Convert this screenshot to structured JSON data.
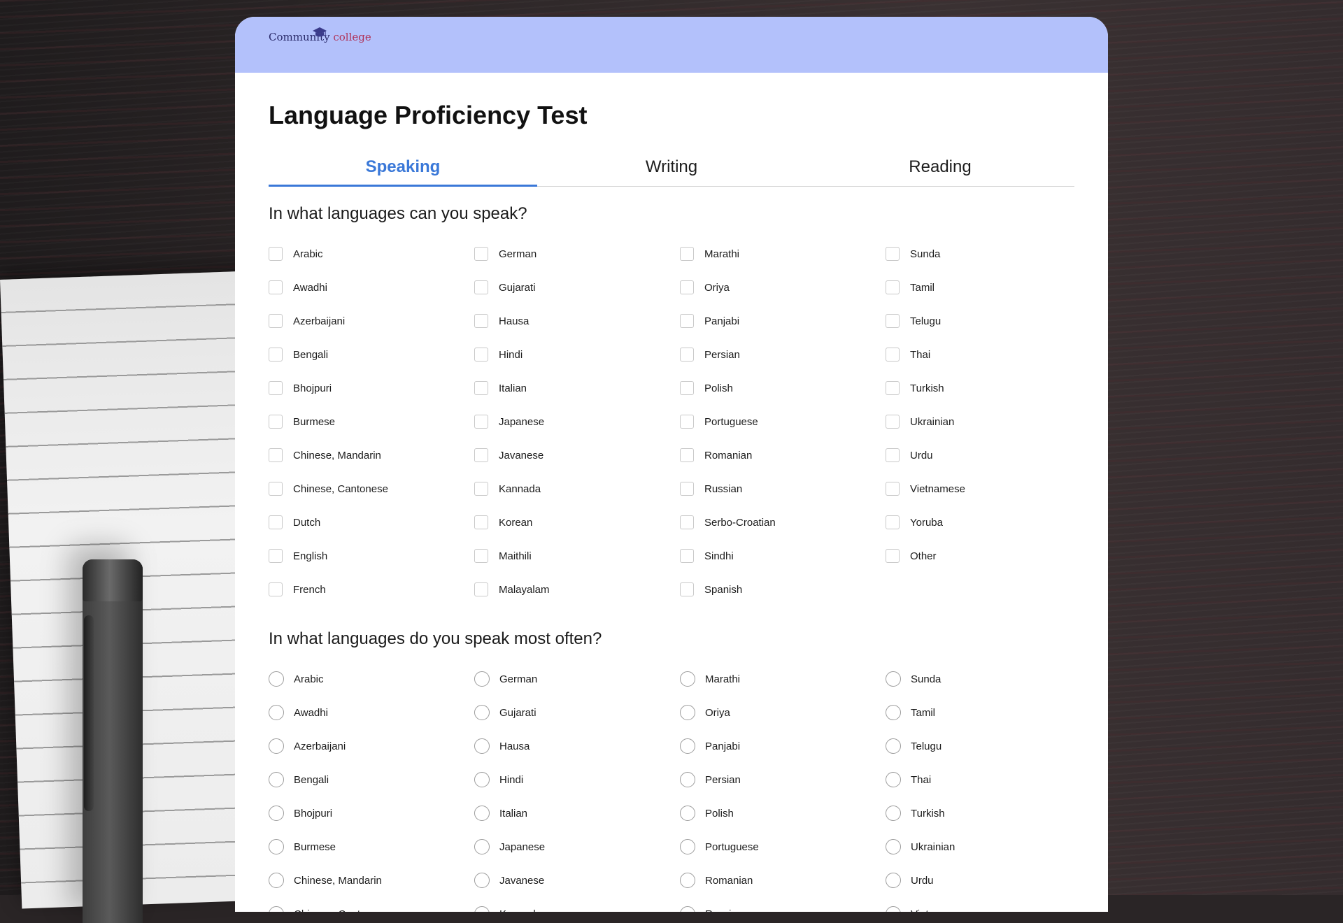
{
  "header": {
    "logo_word1": "Community",
    "logo_word2": "college"
  },
  "page": {
    "title": "Language Proficiency Test"
  },
  "tabs": [
    {
      "label": "Speaking",
      "active": true
    },
    {
      "label": "Writing",
      "active": false
    },
    {
      "label": "Reading",
      "active": false
    }
  ],
  "questions": {
    "q1": "In what languages can you speak?",
    "q2": "In what languages do you speak most often?"
  },
  "languages_checkbox": [
    "Arabic",
    "German",
    "Marathi",
    "Sunda",
    "Awadhi",
    "Gujarati",
    "Oriya",
    "Tamil",
    "Azerbaijani",
    "Hausa",
    "Panjabi",
    "Telugu",
    "Bengali",
    "Hindi",
    "Persian",
    "Thai",
    "Bhojpuri",
    "Italian",
    "Polish",
    "Turkish",
    "Burmese",
    "Japanese",
    "Portuguese",
    "Ukrainian",
    "Chinese, Mandarin",
    "Javanese",
    "Romanian",
    "Urdu",
    "Chinese, Cantonese",
    "Kannada",
    "Russian",
    "Vietnamese",
    "Dutch",
    "Korean",
    "Serbo-Croatian",
    "Yoruba",
    "English",
    "Maithili",
    "Sindhi",
    "Other",
    "French",
    "Malayalam",
    "Spanish"
  ],
  "languages_radio": [
    "Arabic",
    "German",
    "Marathi",
    "Sunda",
    "Awadhi",
    "Gujarati",
    "Oriya",
    "Tamil",
    "Azerbaijani",
    "Hausa",
    "Panjabi",
    "Telugu",
    "Bengali",
    "Hindi",
    "Persian",
    "Thai",
    "Bhojpuri",
    "Italian",
    "Polish",
    "Turkish",
    "Burmese",
    "Japanese",
    "Portuguese",
    "Ukrainian",
    "Chinese, Mandarin",
    "Javanese",
    "Romanian",
    "Urdu",
    "Chinese, Cantonese",
    "Kannada",
    "Russian",
    "Vietnamese"
  ],
  "colors": {
    "accent": "#3a78d8",
    "header_bg": "#b3c1fb"
  }
}
